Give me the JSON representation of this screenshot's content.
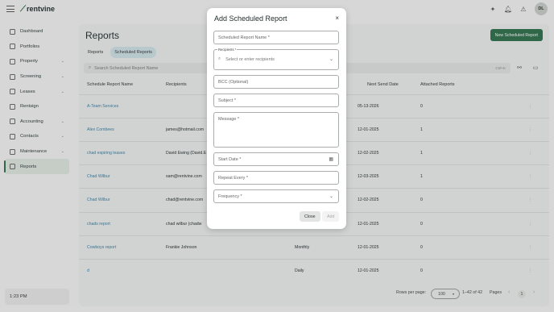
{
  "app": {
    "logo_text": "rentvine",
    "avatar_initials": "DL"
  },
  "sidebar": {
    "items": [
      {
        "label": "Dashboard",
        "has_chevron": false
      },
      {
        "label": "Portfolios",
        "has_chevron": false
      },
      {
        "label": "Property",
        "has_chevron": true
      },
      {
        "label": "Screening",
        "has_chevron": true
      },
      {
        "label": "Leases",
        "has_chevron": true
      },
      {
        "label": "Rentsign",
        "has_chevron": false
      },
      {
        "label": "Accounting",
        "has_chevron": true
      },
      {
        "label": "Contacts",
        "has_chevron": true
      },
      {
        "label": "Maintenance",
        "has_chevron": true
      },
      {
        "label": "Reports",
        "has_chevron": false,
        "active": true
      }
    ],
    "time": "1:23 PM"
  },
  "main": {
    "title": "Reports",
    "new_button": "New Scheduled Report",
    "tabs": [
      {
        "label": "Reports",
        "selected": false
      },
      {
        "label": "Scheduled Reports",
        "selected": true
      }
    ],
    "search_placeholder": "Search Scheduled Report Name",
    "search_shortcut": "Ctrl+K",
    "table": {
      "columns": [
        "Schedule Report Name",
        "Recipients",
        "Next Send Date",
        "Attached Reports"
      ],
      "rows": [
        {
          "name": "A-Team Services",
          "recipients": "",
          "frequency": "",
          "next": "05-13-2026",
          "attached": "0"
        },
        {
          "name": "Alex Combees",
          "recipients": "james@hotmail.com",
          "frequency": "",
          "next": "12-01-2025",
          "attached": "1"
        },
        {
          "name": "chad expiring leases",
          "recipients": "David Ewing (David.E",
          "frequency": "",
          "next": "12-02-2025",
          "attached": "1"
        },
        {
          "name": "Chad Wilbur",
          "recipients": "sam@rentvine.com",
          "frequency": "",
          "next": "12-03-2025",
          "attached": "1"
        },
        {
          "name": "Chad Wilbur",
          "recipients": "chad@rentvine.com",
          "frequency": "",
          "next": "12-02-2025",
          "attached": "0"
        },
        {
          "name": "chads report",
          "recipients": "chad wilbur (chadw",
          "frequency": "",
          "next": "12-01-2025",
          "attached": "0"
        },
        {
          "name": "Cowboys report",
          "recipients": "Frankie Johnson",
          "frequency": "Monthly",
          "next": "12-01-2025",
          "attached": "0"
        },
        {
          "name": "d",
          "recipients": "",
          "frequency": "Daily",
          "next": "12-01-2025",
          "attached": "0"
        }
      ]
    },
    "footer": {
      "rows_per_page_label": "Rows per page:",
      "rows_per_page_value": "100",
      "range": "1–42 of 42",
      "pages_label": "Pages",
      "current_page": "1"
    }
  },
  "modal": {
    "title": "Add Scheduled Report",
    "fields": {
      "report_name": "Scheduled Report Name *",
      "recipients_label": "Recipients *",
      "recipients_placeholder": "Select or enter recipients",
      "bcc": "BCC (Optional)",
      "subject": "Subject *",
      "message": "Message *",
      "start_date": "Start Date *",
      "repeat_every": "Repeat Every *",
      "frequency": "Frequency *"
    },
    "close_button": "Close",
    "add_button": "Add"
  }
}
